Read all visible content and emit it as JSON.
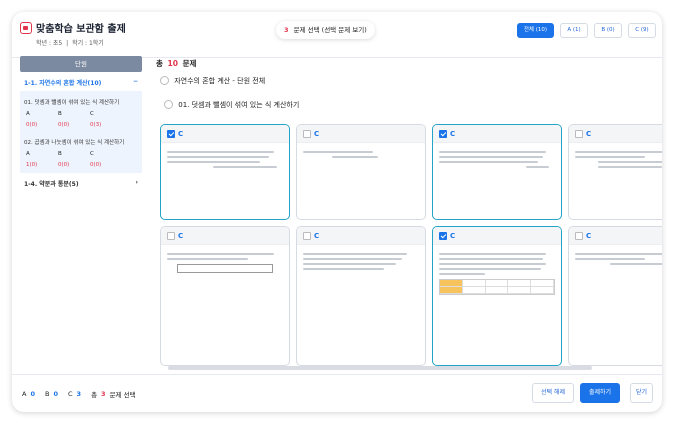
{
  "header": {
    "title": "맞춤학습 보관함 출제",
    "grade_label": "학년 : 초5",
    "sep": "|",
    "term_label": "학기 : 1학기",
    "selected_count": "3",
    "selected_text": "문제 선택 (선택 문제 보기)"
  },
  "filters": [
    {
      "label": "전체 (10)",
      "active": true
    },
    {
      "label": "A (1)",
      "active": false
    },
    {
      "label": "B (0)",
      "active": false
    },
    {
      "label": "C (9)",
      "active": false
    }
  ],
  "sidebar": {
    "heading": "단원",
    "unit1": {
      "label": "1-1. 자연수의 혼합 계산(10)",
      "chev": "−"
    },
    "lessons": [
      {
        "label": "01. 덧셈과 뺄셈이 섞여 있는 식 계산하기",
        "cols": [
          "A",
          "B",
          "C"
        ],
        "vals": [
          "0(0)",
          "0(0)",
          "0(3)"
        ]
      },
      {
        "label": "02. 곱셈과 나눗셈이 섞여 있는 식 계산하기",
        "cols": [
          "A",
          "B",
          "C"
        ],
        "vals": [
          "1(0)",
          "0(0)",
          "0(0)"
        ]
      }
    ],
    "unit2": {
      "label": "1-4. 약분과 통분(5)",
      "chev": "›"
    }
  },
  "main": {
    "total_prefix": "총",
    "total": "10",
    "total_suffix": "문제",
    "tree_unit": "자연수의 혼합 계산 - 단원 전체",
    "tree_lesson": "01. 덧셈과 뺄셈이 섞여 있는 식 계산하기"
  },
  "cards": [
    {
      "grade": "C",
      "checked": true
    },
    {
      "grade": "C",
      "checked": false
    },
    {
      "grade": "C",
      "checked": true
    },
    {
      "grade": "C",
      "checked": false
    },
    {
      "grade": "C",
      "checked": false
    },
    {
      "grade": "C",
      "checked": false
    },
    {
      "grade": "C",
      "checked": true
    },
    {
      "grade": "C",
      "checked": false
    }
  ],
  "footer": {
    "a_label": "A",
    "a_val": "0",
    "b_label": "B",
    "b_val": "0",
    "c_label": "C",
    "c_val": "3",
    "total_prefix": "총",
    "total_val": "3",
    "total_suffix": "문제 선택",
    "deselect": "선택 해제",
    "submit": "출제하기",
    "close": "닫기"
  },
  "colors": {
    "accent": "#1a73e8",
    "red": "#e0364d",
    "teal": "#22a3c7"
  }
}
